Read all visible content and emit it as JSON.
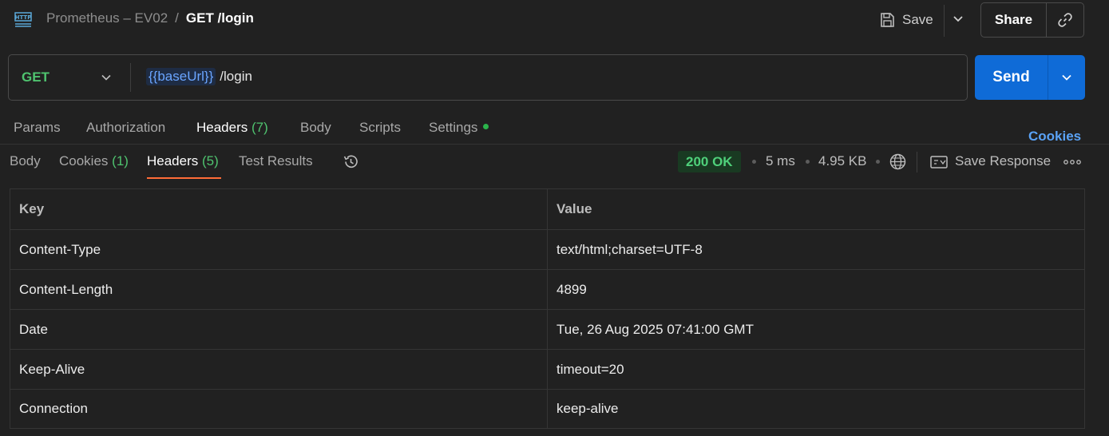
{
  "header": {
    "collection": "Prometheus – EV02",
    "separator": "/",
    "request_name": "GET /login",
    "save_label": "Save",
    "share_label": "Share"
  },
  "urlbar": {
    "method": "GET",
    "base_url_var": "{{baseUrl}}",
    "path": "/login",
    "send_label": "Send"
  },
  "request_tabs": [
    {
      "label": "Params",
      "count": ""
    },
    {
      "label": "Authorization",
      "count": ""
    },
    {
      "label": "Headers",
      "count": "(7)"
    },
    {
      "label": "Body",
      "count": ""
    },
    {
      "label": "Scripts",
      "count": ""
    },
    {
      "label": "Settings",
      "count": ""
    }
  ],
  "cookies_link": "Cookies",
  "response_tabs": [
    {
      "label": "Body",
      "count": ""
    },
    {
      "label": "Cookies",
      "count": "(1)"
    },
    {
      "label": "Headers",
      "count": "(5)"
    },
    {
      "label": "Test Results",
      "count": ""
    }
  ],
  "response_meta": {
    "status": "200 OK",
    "time": "5 ms",
    "size": "4.95 KB",
    "save_response_label": "Save Response"
  },
  "headers_table": {
    "columns": [
      "Key",
      "Value"
    ],
    "rows": [
      {
        "key": "Content-Type",
        "value": "text/html;charset=UTF-8"
      },
      {
        "key": "Content-Length",
        "value": "4899"
      },
      {
        "key": "Date",
        "value": "Tue, 26 Aug 2025 07:41:00 GMT"
      },
      {
        "key": "Keep-Alive",
        "value": "timeout=20"
      },
      {
        "key": "Connection",
        "value": "keep-alive"
      }
    ]
  },
  "colors": {
    "background": "#212121",
    "send_button": "#0f6bd7",
    "method_get": "#4fc36f",
    "accent_underline": "#ff6c37",
    "status_ok": "#4fd07a",
    "link": "#5aa2f5"
  }
}
